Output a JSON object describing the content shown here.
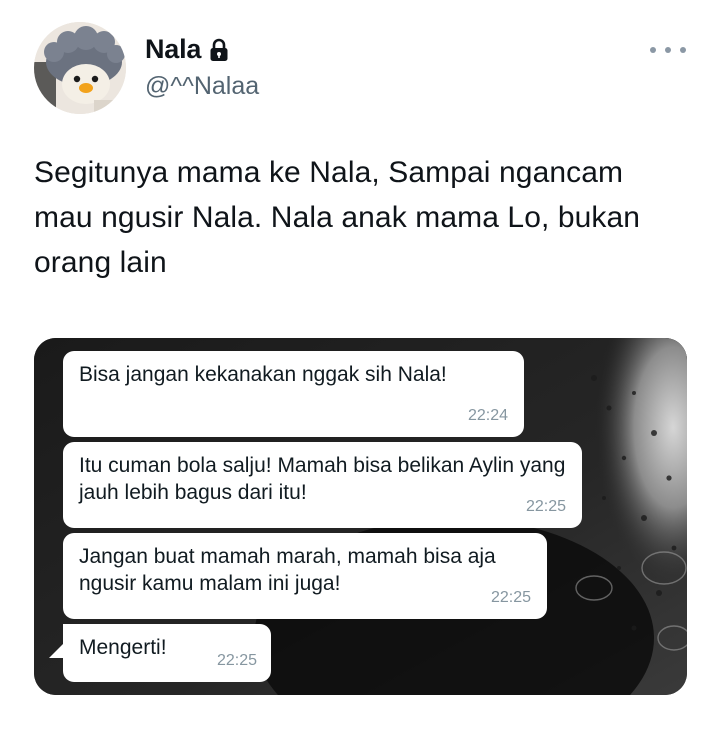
{
  "user": {
    "display_name": "Nala",
    "handle": "@^^Nalaa",
    "avatar_icon": "penguin-avatar-icon",
    "lock_icon": "lock-icon"
  },
  "more_icon": "more-horizontal-icon",
  "tweet": {
    "text": "Segitunya mama ke Nala, Sampai ngancam mau ngusir Nala. Nala anak mama Lo, bukan orang lain"
  },
  "chat": {
    "messages": [
      {
        "text": "Bisa jangan kekanakan nggak sih Nala!",
        "time": "22:24"
      },
      {
        "text": "Itu cuman bola salju! Mamah bisa belikan Aylin yang jauh lebih bagus dari itu!",
        "time": "22:25"
      },
      {
        "text": "Jangan buat mamah marah, mamah bisa aja ngusir kamu malam ini juga!",
        "time": "22:25"
      },
      {
        "text": "Mengerti!",
        "time": "22:25"
      }
    ]
  },
  "colors": {
    "text_primary": "#0f1419",
    "text_secondary": "#536471",
    "bubble": "#ffffff",
    "timestamp": "#8696a0"
  }
}
